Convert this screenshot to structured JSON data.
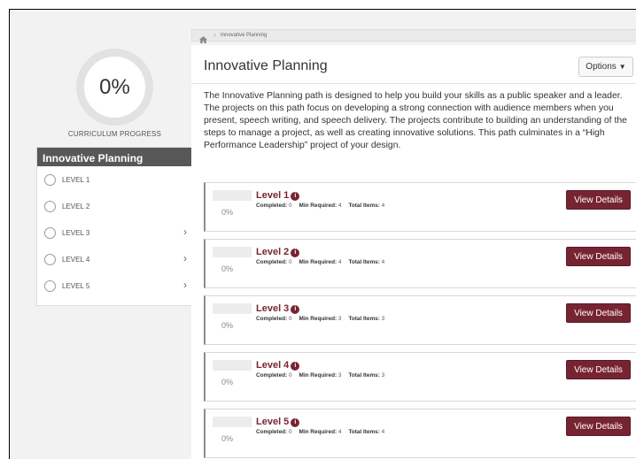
{
  "breadcrumb": {
    "current": "Innovative Planning"
  },
  "sidebar": {
    "progress_value": "0%",
    "progress_label": "CURRICULUM PROGRESS",
    "path_title": "Innovative Planning",
    "levels": [
      {
        "label": "LEVEL 1",
        "has_chevron": false
      },
      {
        "label": "LEVEL 2",
        "has_chevron": false
      },
      {
        "label": "LEVEL 3",
        "has_chevron": true
      },
      {
        "label": "LEVEL 4",
        "has_chevron": true
      },
      {
        "label": "LEVEL 5",
        "has_chevron": true
      }
    ],
    "chevron": "›"
  },
  "main": {
    "title": "Innovative Planning",
    "options_label": "Options",
    "description": "The Innovative Planning path is designed to help you build your skills as a public speaker and a leader. The projects on this path focus on developing a strong connection with audience members when you present, speech writing, and speech delivery. The projects contribute to building an understanding of the steps to manage a project, as well as creating innovative solutions. This path culminates in a “High Performance Leadership” project of your design.",
    "labels": {
      "completed": "Completed:",
      "min_required": "Min Required:",
      "total_items": "Total Items:"
    },
    "view_details_label": "View Details",
    "levels": [
      {
        "title": "Level 1",
        "percent": "0%",
        "completed": "0",
        "min_required": "4",
        "total_items": "4"
      },
      {
        "title": "Level 2",
        "percent": "0%",
        "completed": "0",
        "min_required": "4",
        "total_items": "4"
      },
      {
        "title": "Level 3",
        "percent": "0%",
        "completed": "0",
        "min_required": "3",
        "total_items": "3"
      },
      {
        "title": "Level 4",
        "percent": "0%",
        "completed": "0",
        "min_required": "3",
        "total_items": "3"
      },
      {
        "title": "Level 5",
        "percent": "0%",
        "completed": "0",
        "min_required": "4",
        "total_items": "4"
      }
    ]
  },
  "colors": {
    "accent": "#772432",
    "sidebar_header": "#585858",
    "background": "#f2f2f2"
  }
}
